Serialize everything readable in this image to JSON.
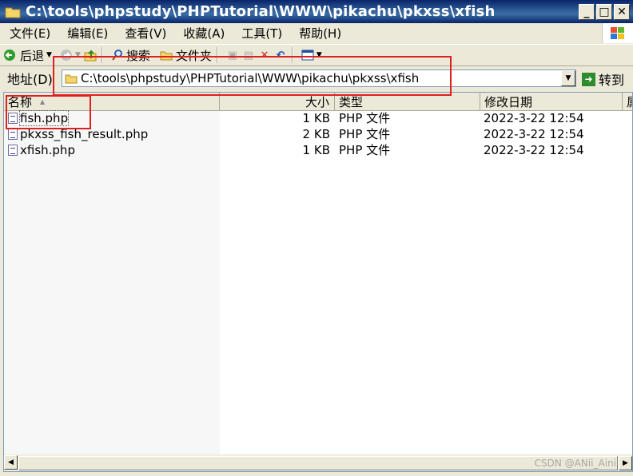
{
  "window": {
    "title": "C:\\tools\\phpstudy\\PHPTutorial\\WWW\\pikachu\\pkxss\\xfish"
  },
  "menu": [
    "文件(E)",
    "编辑(E)",
    "查看(V)",
    "收藏(A)",
    "工具(T)",
    "帮助(H)"
  ],
  "toolbar": {
    "back_label": "后退",
    "search_label": "搜索",
    "folders_label": "文件夹"
  },
  "address": {
    "label": "地址(D)",
    "value": "C:\\tools\\phpstudy\\PHPTutorial\\WWW\\pikachu\\pkxss\\xfish",
    "go_label": "转到"
  },
  "columns": {
    "name": "名称",
    "size": "大小",
    "type": "类型",
    "modified": "修改日期",
    "extra": "属"
  },
  "files": [
    {
      "name": "fish.php",
      "size": "1 KB",
      "type": "PHP 文件",
      "modified": "2022-3-22 12:54"
    },
    {
      "name": "pkxss_fish_result.php",
      "size": "2 KB",
      "type": "PHP 文件",
      "modified": "2022-3-22 12:54"
    },
    {
      "name": "xfish.php",
      "size": "1 KB",
      "type": "PHP 文件",
      "modified": "2022-3-22 12:54"
    }
  ],
  "watermark": "CSDN @ANii_Aini",
  "colors": {
    "title_bar": "#0A246A",
    "highlight_box": "#E02020",
    "window_face": "#ECE9D8"
  }
}
